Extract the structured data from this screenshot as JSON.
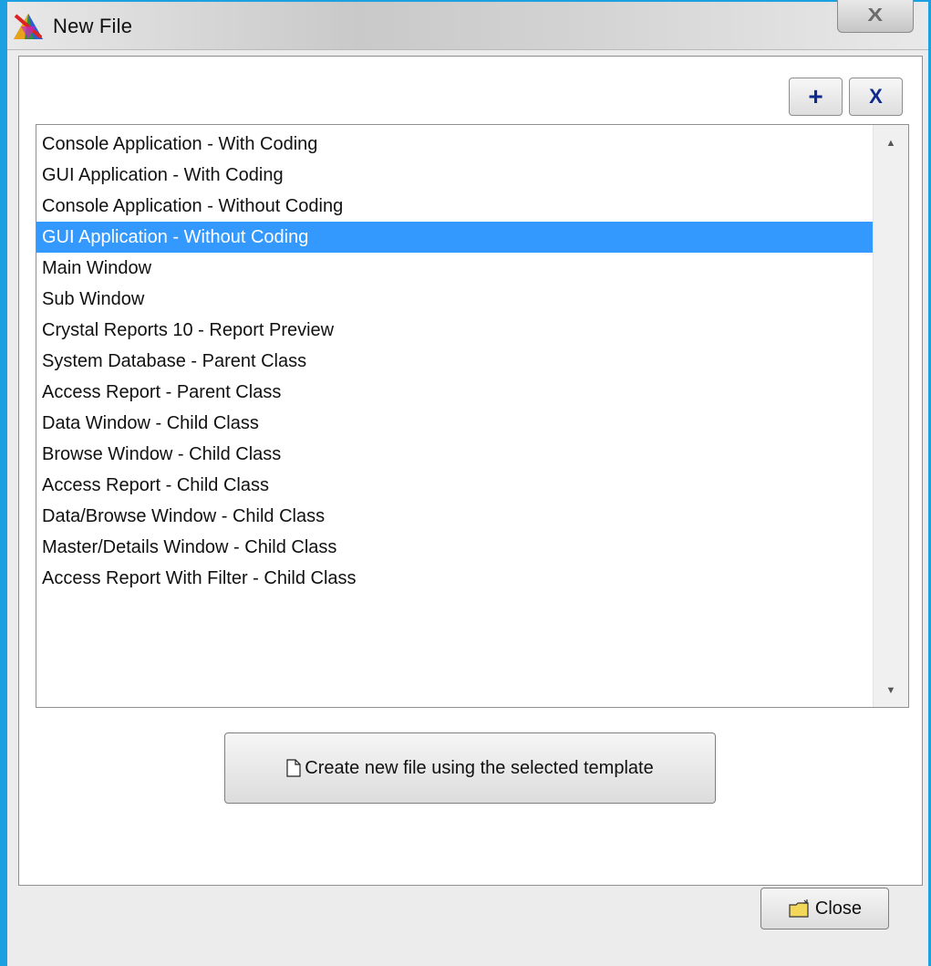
{
  "window": {
    "title": "New File",
    "close_glyph": "X",
    "icon": "app-logo-icon"
  },
  "toolbar": {
    "add_label": "+",
    "remove_label": "X"
  },
  "templates": {
    "items": [
      "Console Application - With Coding",
      "GUI Application - With Coding",
      "Console Application - Without Coding",
      "GUI Application - Without Coding",
      "Main Window",
      "Sub Window",
      "Crystal Reports 10 - Report Preview",
      "System Database - Parent Class",
      "Access Report - Parent Class",
      "Data Window - Child Class",
      "Browse Window - Child Class",
      "Access Report - Child Class",
      "Data/Browse Window - Child Class",
      "Master/Details Window - Child Class",
      "Access Report With Filter - Child Class"
    ],
    "selected": "GUI Application - Without Coding",
    "scroll_up_icon": "scroll-up-arrow-icon",
    "scroll_down_icon": "scroll-down-arrow-icon"
  },
  "actions": {
    "create_label": "Create new file using the selected template",
    "create_icon": "new-document-icon",
    "close_label": "Close",
    "close_icon": "open-folder-icon"
  },
  "colors": {
    "selection": "#3399ff",
    "window_frame": "#1ba0e2",
    "toolbar_text": "#0d2a8c"
  }
}
